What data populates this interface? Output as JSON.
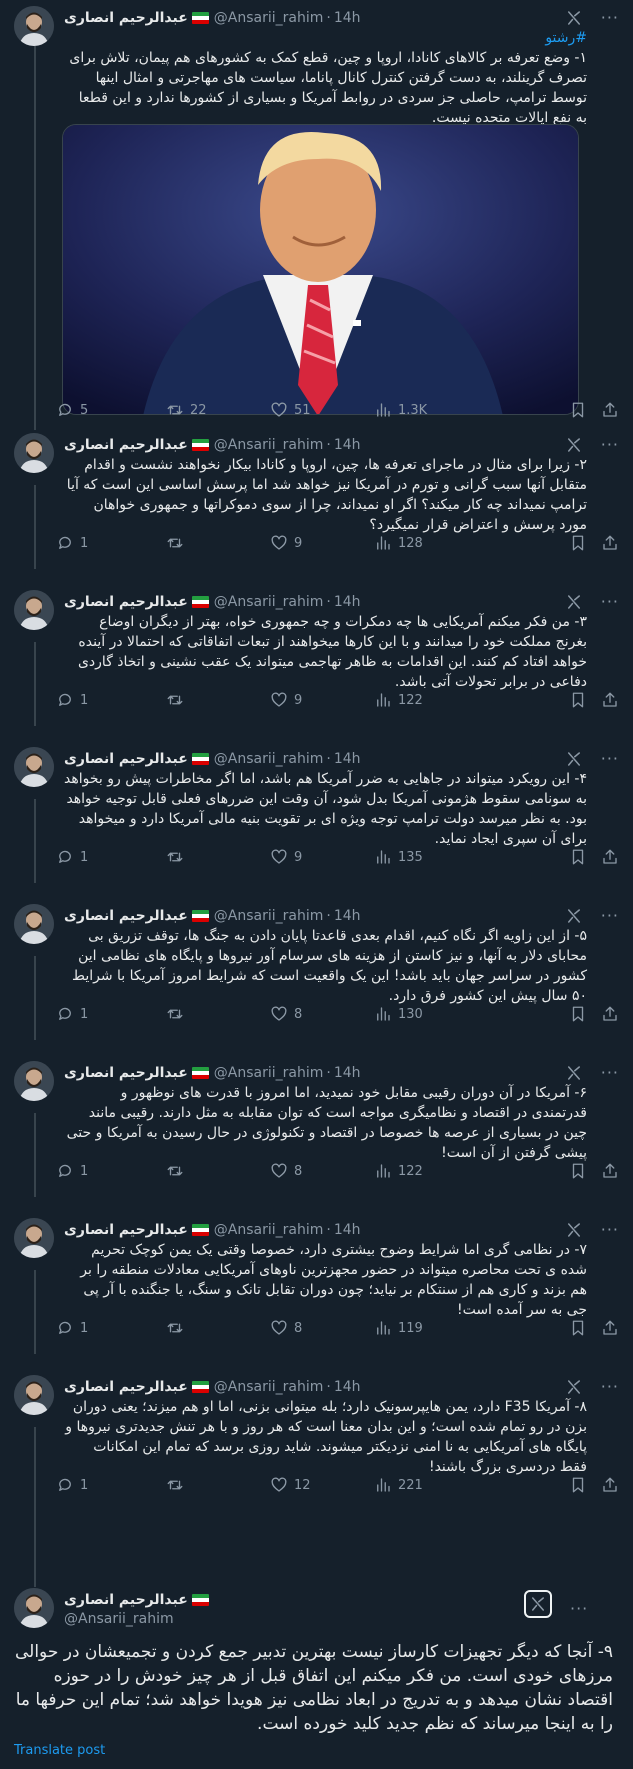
{
  "author": {
    "name": "عبدالرحیم انصاری",
    "handle": "@Ansarii_rahim",
    "time": "14h"
  },
  "colors": {
    "background": "#15202b",
    "text": "#e7e9ea",
    "muted": "#8b98a5",
    "link": "#1d9bf0"
  },
  "icons": [
    "grok-icon",
    "more-icon",
    "reply-icon",
    "retweet-icon",
    "like-icon",
    "views-icon",
    "bookmark-icon",
    "share-icon"
  ],
  "tweets": [
    {
      "hashtag": "#رشتو",
      "text": "۱- وضع تعرفه بر کالاهای کانادا، اروپا و چین، قطع کمک به کشورهای هم پیمان، تلاش برای تصرف گرینلند، به دست گرفتن کنترل کانال پاناما، سیاست های مهاجرتی و امثال اینها توسط ترامپ، حاصلی جز سردی در روابط آمریکا و بسیاری از کشورها ندارد و این قطعا به نفع ایالات متحده نیست.",
      "replies": "5",
      "retweets": "22",
      "likes": "51",
      "views": "1.3K"
    },
    {
      "text": "۲- زیرا برای مثال در ماجرای تعرفه ها، چین، اروپا و کانادا بیکار نخواهند نشست و اقدام متقابل آنها سبب گرانی و تورم در آمریکا نیز خواهد شد اما پرسش اساسی این است که آیا ترامپ نمیداند چه کار میکند؟ اگر او نمیداند، چرا از سوی دموکراتها و جمهوری خواهان مورد پرسش و اعتراض قرار نمیگیرد؟",
      "replies": "1",
      "retweets": "",
      "likes": "9",
      "views": "128"
    },
    {
      "text": "۳- من فکر میکنم آمریکایی ها چه دمکرات و چه جمهوری خواه، بهتر از دیگران اوضاع بغرنج مملکت خود را میدانند و با این کارها میخواهند از تبعات اتفاقاتی که احتمالا در آینده خواهد افتاد کم کنند. این اقدامات به ظاهر تهاجمی میتواند یک عقب نشینی و اتخاذ گاردی دفاعی در برابر تحولات آتی باشد.",
      "replies": "1",
      "retweets": "",
      "likes": "9",
      "views": "122"
    },
    {
      "text": "۴- این رویکرد میتواند در جاهایی به ضرر آمریکا هم باشد، اما اگر مخاطرات پیش رو بخواهد به سونامی سقوط هژمونی آمریکا بدل شود، آن وقت این ضررهای فعلی قابل توجیه خواهد بود. به نظر میرسد دولت ترامپ توجه ویژه ای بر تقویت بنیه مالی آمریکا دارد و میخواهد برای آن سپری ایجاد نماید.",
      "replies": "1",
      "retweets": "",
      "likes": "9",
      "views": "135"
    },
    {
      "text": "۵- از این زاویه اگر نگاه کنیم، اقدام بعدی قاعدتا پایان دادن به جنگ ها، توقف تزریق بی محابای دلار به آنها، و نیز کاستن از هزینه های سرسام آور نیروها و پایگاه های نظامی این کشور در سراسر جهان باید باشد! این یک واقعیت است که شرایط امروز آمریکا با شرایط ۵۰ سال پیش این کشور فرق دارد.",
      "replies": "1",
      "retweets": "",
      "likes": "8",
      "views": "130"
    },
    {
      "text": "۶- آمریکا در آن دوران رقیبی مقابل خود نمیدید، اما امروز با قدرت های نوظهور و قدرتمندی در اقتصاد و نظامیگری مواجه است که توان مقابله به مثل دارند. رقیبی مانند چین در بسیاری از عرصه ها خصوصا در اقتصاد و تکنولوژی در حال رسیدن به آمریکا و حتی پیشی گرفتن از آن است!",
      "replies": "1",
      "retweets": "",
      "likes": "8",
      "views": "122"
    },
    {
      "text": "۷- در نظامی گری اما شرایط وضوح بیشتری دارد، خصوصا وقتی یک یمن کوچک تحریم شده ی تحت محاصره میتواند در حضور مجهزترین ناوهای آمریکایی معادلات منطقه را بر هم بزند و کاری هم از سنتکام بر نیاید؛ چون دوران تقابل تانک و سنگ، یا جنگنده با آر پی جی به سر آمده است!",
      "replies": "1",
      "retweets": "",
      "likes": "8",
      "views": "119"
    },
    {
      "text": "۸- آمریکا F35 دارد، یمن هایپرسونیک دارد؛ بله میتوانی بزنی، اما او هم میزند؛ یعنی دوران بزن در رو تمام شده است؛ و این بدان معنا است که هر روز و با هر تنش جدیدتری نیروها و پایگاه های آمریکایی به نا امنی نزدیکتر میشوند. شاید روزی برسد که تمام این امکانات فقط دردسری بزرگ باشند!",
      "replies": "1",
      "retweets": "",
      "likes": "12",
      "views": "221"
    }
  ],
  "main_tweet": {
    "text": "۹- آنجا که دیگر تجهیزات کارساز نیست بهترین تدبیر جمع کردن و تجمیعشان در حوالی مرزهای خودی است. من فکر میکنم این اتفاق قبل از هر چیز خودش را در حوزه اقتصاد نشان میدهد و به تدریج در ابعاد نظامی نیز هویدا خواهد شد؛ تمام این حرفها ما را به اینجا میرساند که نظم جدید کلید خورده است.",
    "translate_label": "Translate post"
  }
}
